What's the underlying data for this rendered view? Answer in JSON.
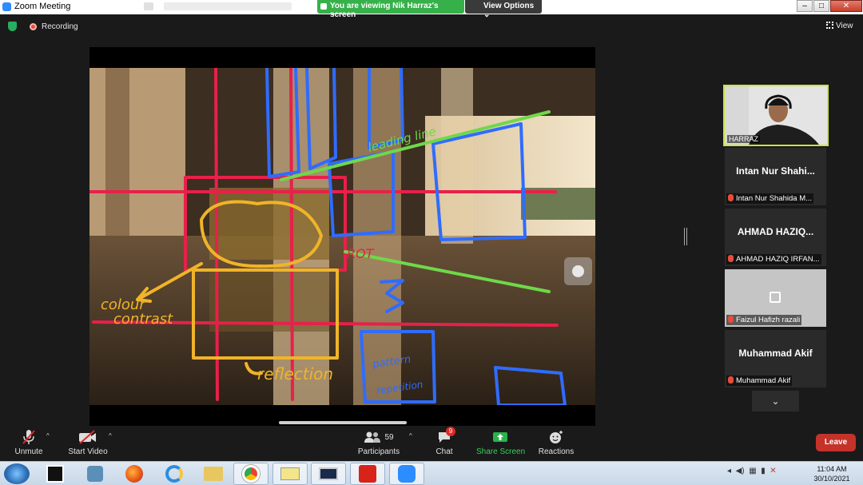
{
  "window": {
    "title": "Zoom Meeting",
    "share_banner": "You are viewing Nik Harraz's screen",
    "view_options": "View Options",
    "controls": [
      "–",
      "□",
      "✕"
    ]
  },
  "topbar": {
    "recording": "Recording",
    "view": "View"
  },
  "annotations": {
    "leading_line": "leading line",
    "rot": "ROT",
    "colour_contrast_1": "colour",
    "colour_contrast_2": "contrast",
    "reflection": "reflection",
    "pattern_1": "pattern",
    "pattern_2": "repetition",
    "number": "5"
  },
  "participants_panel": {
    "camera_tile": {
      "name": "HARRAZ"
    },
    "tiles": [
      {
        "big": "Intan Nur Shahi...",
        "foot": "Intan Nur Shahida M..."
      },
      {
        "big": "AHMAD  HAZIQ...",
        "foot": "AHMAD HAZIQ IRFAN..."
      },
      {
        "big": "",
        "foot": "Faizul Hafizh razali"
      },
      {
        "big": "Muhammad Akif",
        "foot": "Muhammad Akif"
      }
    ]
  },
  "toolbar": {
    "unmute": "Unmute",
    "start_video": "Start Video",
    "participants": "Participants",
    "participants_count": "59",
    "chat": "Chat",
    "chat_badge": "9",
    "share_screen": "Share Screen",
    "reactions": "Reactions",
    "leave": "Leave"
  },
  "taskbar": {
    "time": "11:04 AM",
    "date": "30/10/2021"
  },
  "colors": {
    "green_banner": "#36b14a",
    "leave_red": "#c4322a",
    "active_speaker": "#c8e63c",
    "annot_red": "#e8204a",
    "annot_blue": "#2f6cff",
    "annot_green": "#6fd84a",
    "annot_orange": "#f0b429"
  }
}
